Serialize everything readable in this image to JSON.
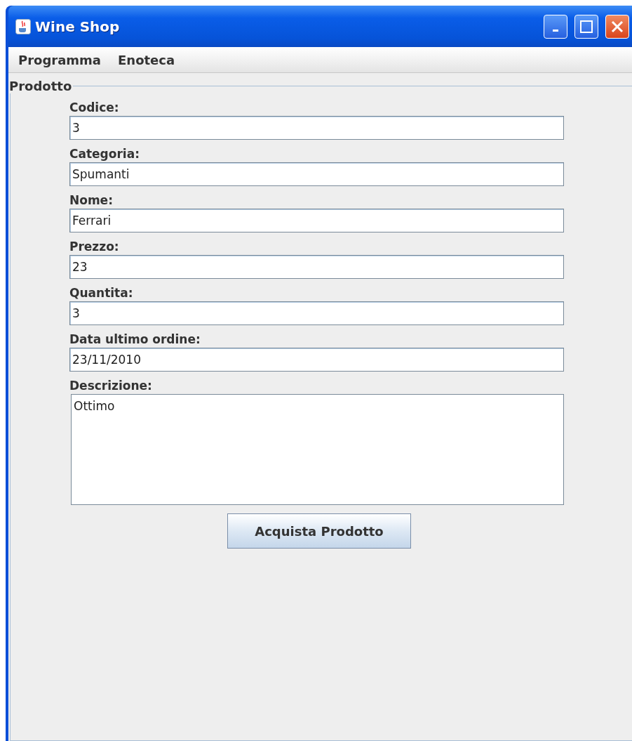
{
  "window": {
    "title": "Wine Shop"
  },
  "menu": [
    "Programma",
    "Enoteca"
  ],
  "panel": {
    "title": "Prodotto",
    "fields": [
      {
        "kind": "line",
        "label": "Codice:",
        "value": "3"
      },
      {
        "kind": "line",
        "label": "Categoria:",
        "value": "Spumanti"
      },
      {
        "kind": "line",
        "label": "Nome:",
        "value": "Ferrari"
      },
      {
        "kind": "line",
        "label": "Prezzo:",
        "value": "23"
      },
      {
        "kind": "line",
        "label": "Quantita:",
        "value": "3"
      },
      {
        "kind": "line",
        "label": "Data ultimo ordine:",
        "value": "23/11/2010"
      },
      {
        "kind": "area",
        "label": "Descrizione:",
        "value": "Ottimo"
      }
    ],
    "button": "Acquista Prodotto"
  }
}
